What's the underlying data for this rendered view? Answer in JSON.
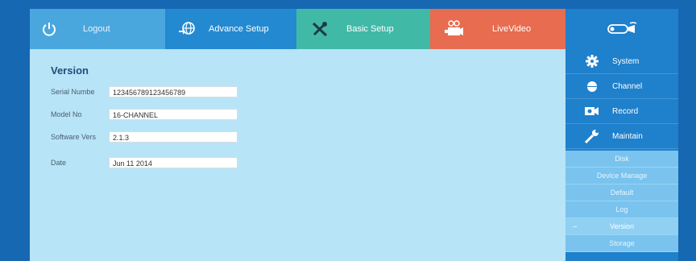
{
  "topnav": {
    "logout": {
      "label": "Logout",
      "icon": "power-icon"
    },
    "advance": {
      "label": "Advance Setup",
      "icon": "globe-icon"
    },
    "basic": {
      "label": "Basic Setup",
      "icon": "tools-icon"
    },
    "live": {
      "label": "LiveVideo",
      "icon": "camera-icon"
    },
    "logo": {
      "icon": "cctv-camera-logo"
    }
  },
  "colors": {
    "logout": "#4aa7de",
    "advance": "#238ad1",
    "basic": "#41b9a7",
    "live": "#e86c4f",
    "sidebar": "#1f80cc",
    "content": "#b8e4f7",
    "submenu": "#79c3ee"
  },
  "version": {
    "title": "Version",
    "fields": [
      {
        "label": "Serial Numbe",
        "value": "123456789123456789"
      },
      {
        "label": "Model No",
        "value": "16-CHANNEL"
      },
      {
        "label": "Software Vers",
        "value": "2.1.3"
      },
      {
        "label": "Date",
        "value": "Jun 11 2014"
      }
    ]
  },
  "sidebar": {
    "items": [
      {
        "label": "System",
        "icon": "gear-icon"
      },
      {
        "label": "Channel",
        "icon": "dome-camera-icon"
      },
      {
        "label": "Record",
        "icon": "record-icon"
      },
      {
        "label": "Maintain",
        "icon": "wrench-icon"
      }
    ],
    "subitems": [
      "Disk",
      "Device Manage",
      "Default",
      "Log",
      "Version",
      "Storage"
    ],
    "active_arrow": "→"
  }
}
